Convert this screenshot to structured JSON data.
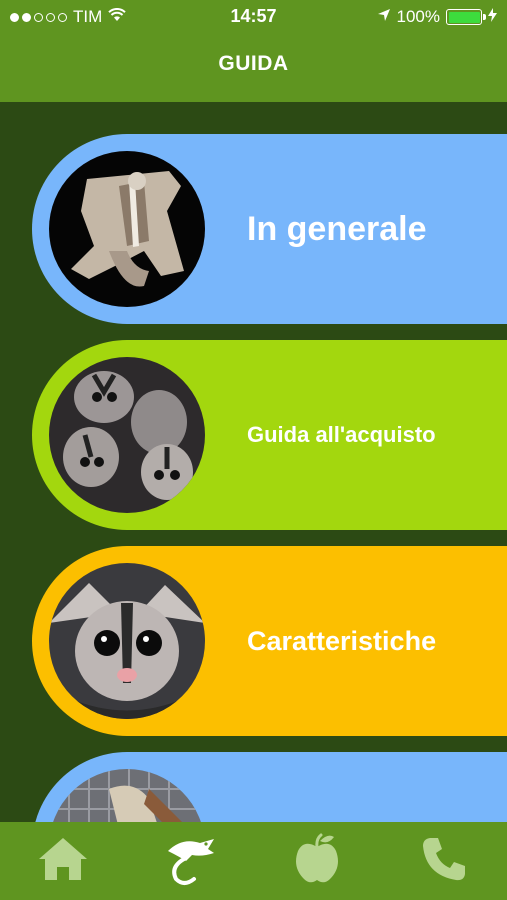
{
  "status_bar": {
    "carrier": "TIM",
    "time": "14:57",
    "battery": "100%",
    "signal_bars_filled": 2,
    "signal_bars_total": 5
  },
  "nav": {
    "title": "GUIDA"
  },
  "cards": [
    {
      "label": "In generale",
      "color": "#78b6fb"
    },
    {
      "label": "Guida all'acquisto",
      "color": "#a3d70e"
    },
    {
      "label": "Caratteristiche",
      "color": "#fcbf00"
    },
    {
      "label": "",
      "color": "#78b6fb"
    }
  ],
  "tabbar": {
    "tabs": [
      {
        "icon": "home-icon"
      },
      {
        "icon": "glider-icon",
        "selected": true
      },
      {
        "icon": "apple-icon"
      },
      {
        "icon": "phone-icon"
      }
    ]
  },
  "colors": {
    "header_green": "#5f9520",
    "background_dark_green": "#2c4a14",
    "tab_icon": "#b7d58f"
  }
}
